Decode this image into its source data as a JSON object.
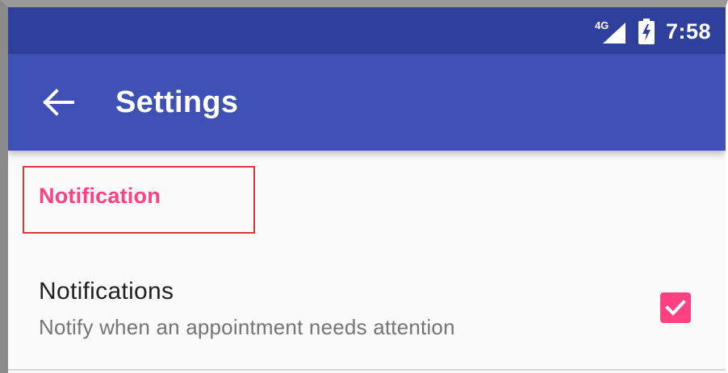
{
  "status_bar": {
    "network_label": "4G",
    "time": "7:58"
  },
  "app_bar": {
    "title": "Settings"
  },
  "category": {
    "title": "Notification"
  },
  "preference": {
    "title": "Notifications",
    "summary": "Notify when an appointment needs attention",
    "checked": true
  },
  "colors": {
    "status_bar": "#2f3f9c",
    "app_bar": "#3f51b5",
    "accent": "#ff4081",
    "highlight_box": "#d9363e",
    "background": "#fafafa"
  },
  "icons": {
    "back": "arrow-left-icon",
    "signal": "signal-icon",
    "battery": "battery-charging-icon",
    "checkbox": "check-icon"
  }
}
